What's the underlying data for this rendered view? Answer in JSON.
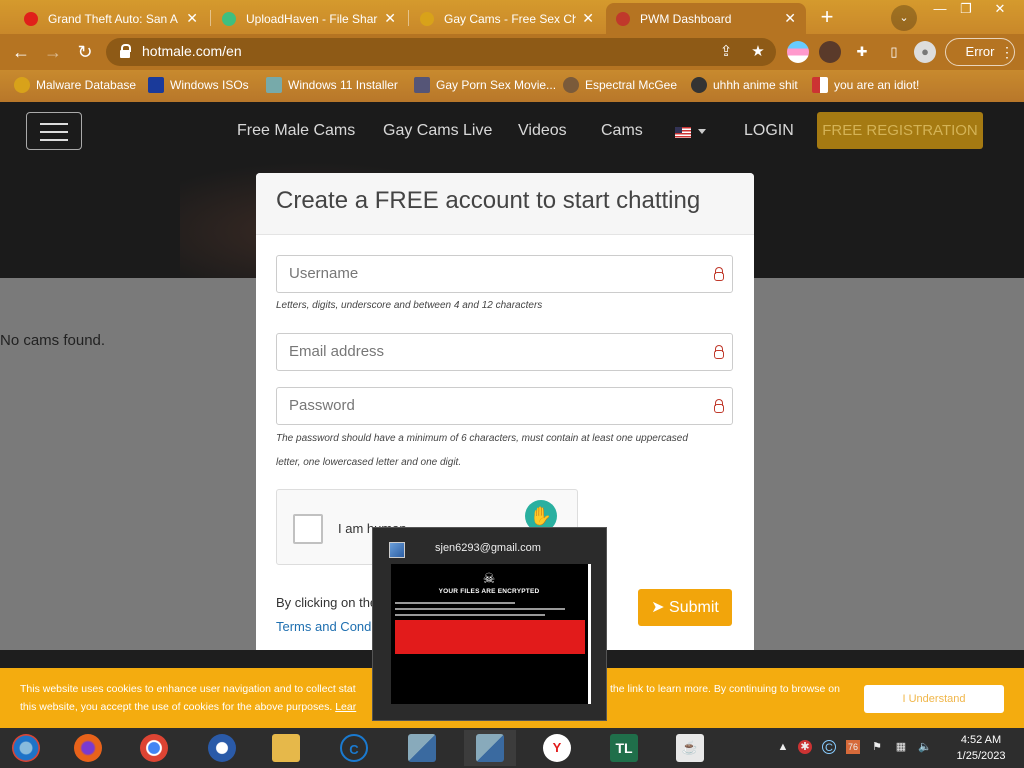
{
  "browser": {
    "tabs": [
      {
        "label": "Grand Theft Auto: San A",
        "favicon_color": "#e0201a",
        "active": false
      },
      {
        "label": "UploadHaven - File Sharin",
        "favicon_color": "#3fbf7f",
        "active": false
      },
      {
        "label": "Gay Cams - Free Sex Cha",
        "favicon_color": "#d8a21a",
        "active": false
      },
      {
        "label": "PWM Dashboard",
        "favicon_color": "#c0392b",
        "active": true
      }
    ],
    "close_glyph": "✕",
    "new_tab_glyph": "+",
    "tab_search_glyph": "⌄",
    "window_controls": {
      "minimize": "—",
      "restore": "❐",
      "close": "✕"
    },
    "url": "hotmale.com/en",
    "profile_error_label": "Error",
    "bookmarks": [
      {
        "label": "Malware Database",
        "icon_color": "#d8a21a"
      },
      {
        "label": "Windows ISOs",
        "icon_color": "#1a3a9a"
      },
      {
        "label": "Windows 11 Installer",
        "icon_color": "#7aa"
      },
      {
        "label": "Gay Porn Sex Movie...",
        "icon_color": "#557"
      },
      {
        "label": "Espectral McGee",
        "icon_color": "#7a5a3a"
      },
      {
        "label": "uhhh anime shit",
        "icon_color": "#333"
      },
      {
        "label": "you are an idiot!",
        "icon_color": "#c33"
      }
    ]
  },
  "site": {
    "nav": [
      "Free Male Cams",
      "Gay Cams Live",
      "Videos",
      "Cams"
    ],
    "login": "LOGIN",
    "free_registration": "FREE REGISTRATION",
    "no_cams": "No cams found.",
    "modal": {
      "title": "Create a FREE account to start chatting",
      "username_placeholder": "Username",
      "username_hint": "Letters, digits, underscore and between 4 and 12 characters",
      "email_placeholder": "Email address",
      "password_placeholder": "Password",
      "password_hint_1": "The password should have a minimum of 6 characters, must contain at least one uppercased",
      "password_hint_2": "letter, one lowercased letter and one digit.",
      "captcha_label": "I am human",
      "by_clicking": "By clicking on the",
      "terms": "Terms and Condit",
      "submit": "Submit"
    },
    "cookie": {
      "text_1": "This website uses cookies to enhance user navigation and to collect stat",
      "text_1b": "the link to learn more. By continuing to browse on",
      "text_2": "this website, you accept the use of cookies for the above purposes.",
      "learn": "Lear",
      "understand": "I Understand"
    }
  },
  "preview": {
    "title": "sjen6293@gmail.com",
    "heading": "YOUR FILES ARE ENCRYPTED"
  },
  "taskbar": {
    "apps": [
      {
        "name": "chromium-app",
        "color": "#1e73c8",
        "glyph": "◉"
      },
      {
        "name": "firefox-app",
        "color": "#e8621a",
        "glyph": "●"
      },
      {
        "name": "chrome-app",
        "color": "#dd4433",
        "glyph": "◎"
      },
      {
        "name": "opera-app",
        "color": "#2a5aa8",
        "glyph": "O"
      },
      {
        "name": "file-explorer-app",
        "color": "#e6b84a",
        "glyph": "▤"
      },
      {
        "name": "ccleaner-app",
        "color": "#1a7ad0",
        "glyph": "C"
      },
      {
        "name": "setup-app-1",
        "color": "#5a7ab0",
        "glyph": "▣"
      },
      {
        "name": "setup-app-2",
        "color": "#5a7ab0",
        "glyph": "▣"
      },
      {
        "name": "yandex-app",
        "color": "#ffffff",
        "glyph": "Y"
      },
      {
        "name": "tl-app",
        "color": "#1f6f4a",
        "glyph": "TL"
      },
      {
        "name": "java-app",
        "color": "#e8e8e8",
        "glyph": "☕"
      }
    ],
    "tray_badge": "76",
    "time": "4:52 AM",
    "date": "1/25/2023"
  }
}
